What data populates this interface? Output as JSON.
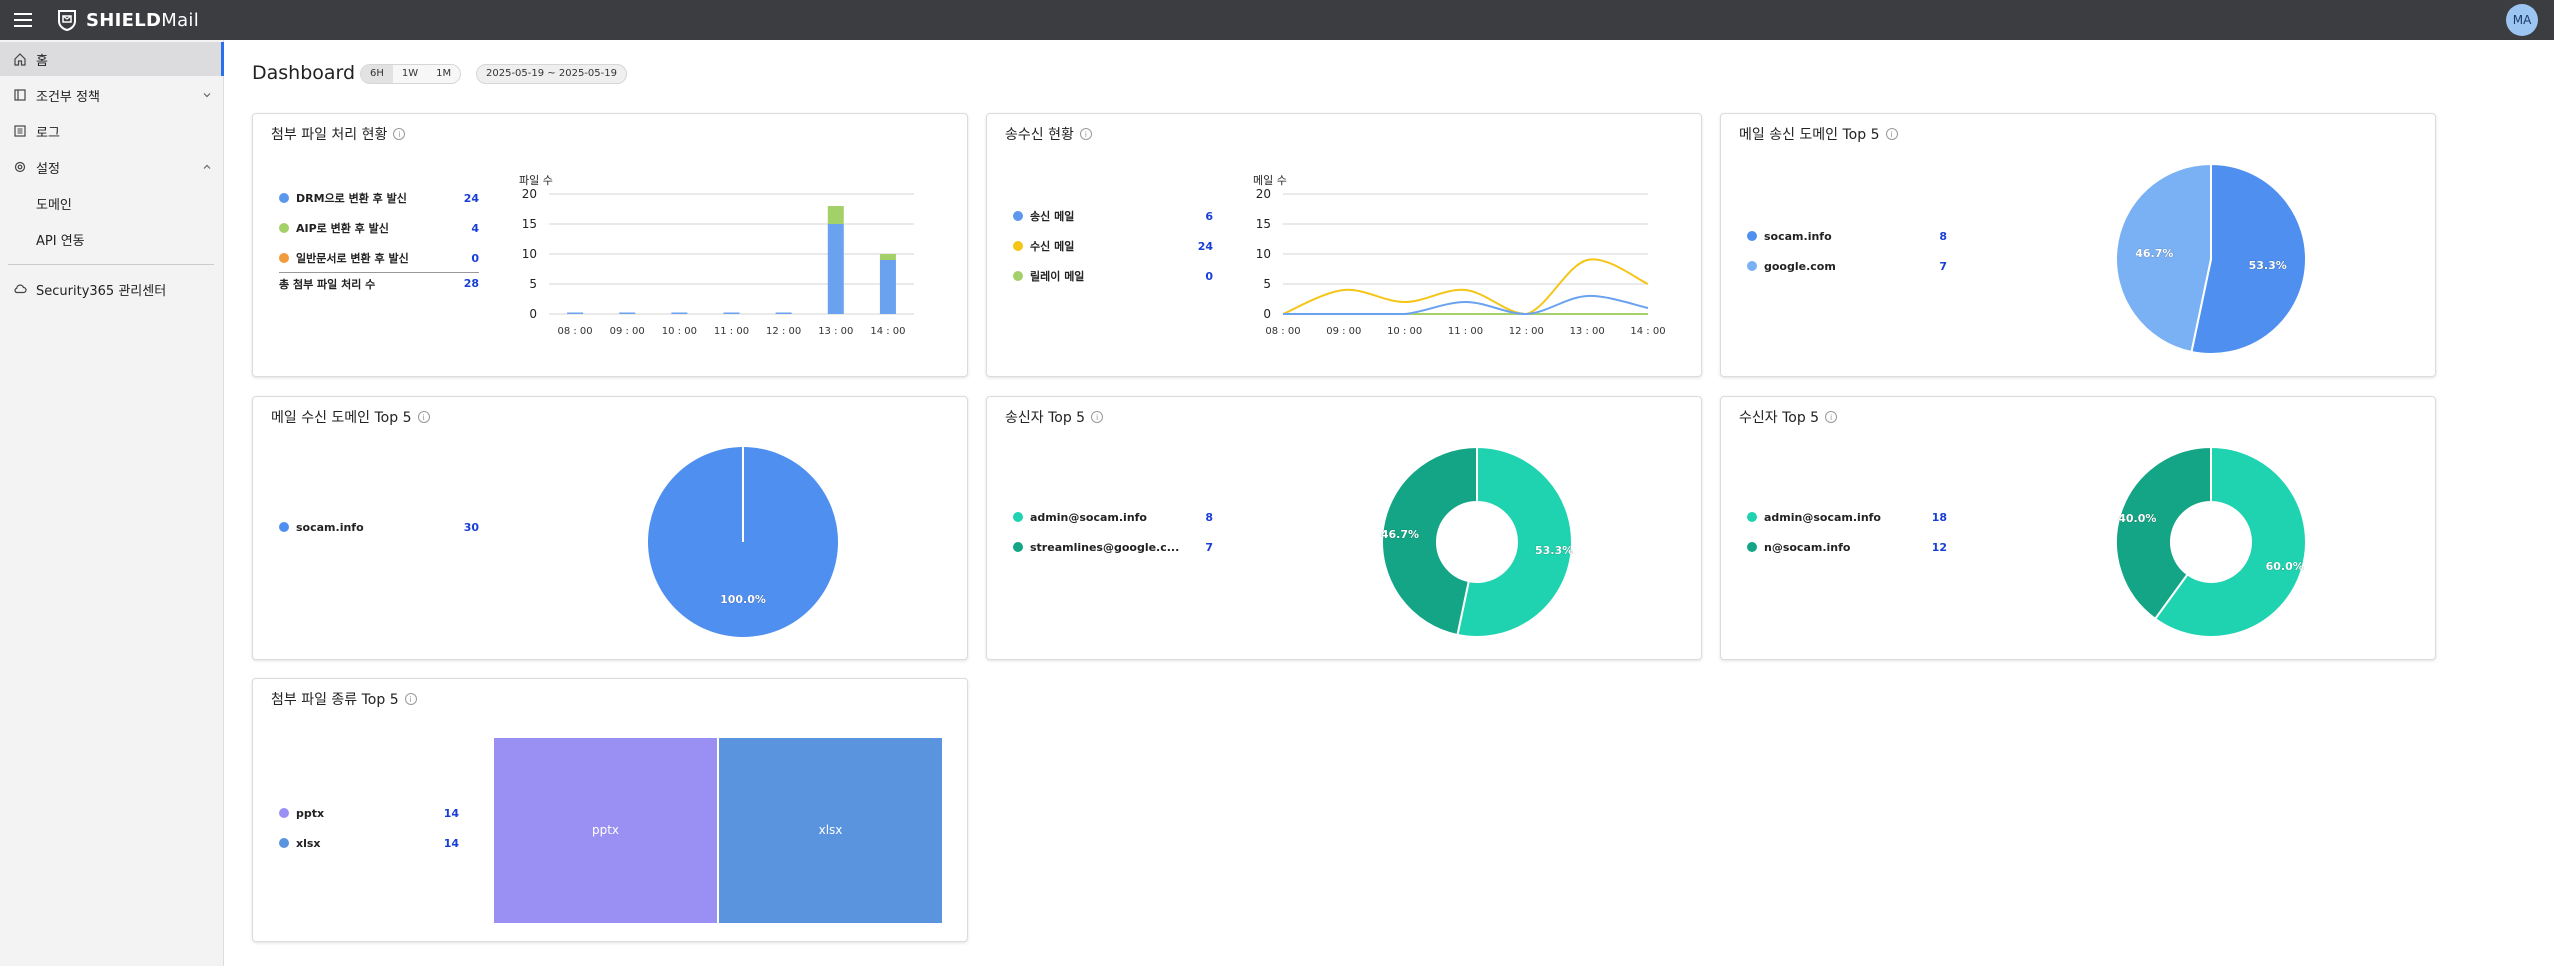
{
  "app": {
    "brand_bold": "SHIELD",
    "brand_light": "Mail",
    "avatar": "MA"
  },
  "sidebar": {
    "items": [
      {
        "label": "홈",
        "icon": "home-icon"
      },
      {
        "label": "조건부 정책",
        "icon": "policy-icon"
      },
      {
        "label": "로그",
        "icon": "log-icon"
      },
      {
        "label": "설정",
        "icon": "settings-icon"
      },
      {
        "label": "도메인"
      },
      {
        "label": "API 연동"
      },
      {
        "label": "Security365 관리센터",
        "icon": "cloud-icon"
      }
    ]
  },
  "header": {
    "title": "Dashboard",
    "ranges": [
      "6H",
      "1W",
      "1M"
    ],
    "date_range": "2025-05-19 ~ 2025-05-19"
  },
  "colors": {
    "blue": "#6aa2f0",
    "green": "#a4d06a",
    "orange": "#f39b3c",
    "yellow": "#f5c518",
    "teal": "#1fd3b0",
    "teal_dark": "#13a585",
    "pie_blue": "#4f8ff0",
    "pie_light": "#7ab1f5",
    "purple": "#9a8ff2",
    "treemap_blue": "#5a93de"
  },
  "cards": {
    "attach": {
      "title": "첨부 파일 처리 현황",
      "legend": [
        {
          "name": "DRM으로 변환 후 발신",
          "value": "24",
          "color": "#5c97ee"
        },
        {
          "name": "AIP로 변환 후 발신",
          "value": "4",
          "color": "#a4d06a"
        },
        {
          "name": "일반문서로 변환 후 발신",
          "value": "0",
          "color": "#f39b3c"
        }
      ],
      "total_label": "총 첨부 파일 처리 수",
      "total_value": "28"
    },
    "sendrecv": {
      "title": "송수신 현황",
      "legend": [
        {
          "name": "송신 메일",
          "value": "6",
          "color": "#5c97ee"
        },
        {
          "name": "수신 메일",
          "value": "24",
          "color": "#f5c518"
        },
        {
          "name": "릴레이 메일",
          "value": "0",
          "color": "#a4d06a"
        }
      ]
    },
    "senddomain": {
      "title": "메일 송신 도메인 Top 5",
      "legend": [
        {
          "name": "socam.info",
          "value": "8",
          "color": "#4f8ff0"
        },
        {
          "name": "google.com",
          "value": "7",
          "color": "#7ab1f5"
        }
      ]
    },
    "recvdomain": {
      "title": "메일 수신 도메인 Top 5",
      "legend": [
        {
          "name": "socam.info",
          "value": "30",
          "color": "#4f8ff0"
        }
      ]
    },
    "senders": {
      "title": "송신자 Top 5",
      "legend": [
        {
          "name": "admin@socam.info",
          "value": "8",
          "color": "#1fd3b0"
        },
        {
          "name": "streamlines@google.c...",
          "value": "7",
          "color": "#13a585"
        }
      ]
    },
    "receivers": {
      "title": "수신자 Top 5",
      "legend": [
        {
          "name": "admin@socam.info",
          "value": "18",
          "color": "#1fd3b0"
        },
        {
          "name": "n@socam.info",
          "value": "12",
          "color": "#13a585"
        }
      ]
    },
    "filetypes": {
      "title": "첨부 파일 종류 Top 5",
      "legend": [
        {
          "name": "pptx",
          "value": "14",
          "color": "#9a8ff2"
        },
        {
          "name": "xlsx",
          "value": "14",
          "color": "#5a93de"
        }
      ]
    }
  },
  "chart_data": [
    {
      "type": "bar",
      "title": "첨부 파일 처리 현황",
      "ylabel": "파일 수",
      "categories": [
        "08 : 00",
        "09 : 00",
        "10 : 00",
        "11 : 00",
        "12 : 00",
        "13 : 00",
        "14 : 00"
      ],
      "ylim": [
        0,
        20
      ],
      "yticks": [
        0,
        5,
        10,
        15,
        20
      ],
      "stacked": true,
      "series": [
        {
          "name": "DRM으로 변환 후 발신",
          "color": "#6aa2f0",
          "values": [
            0,
            0,
            0,
            0,
            0,
            15,
            9
          ]
        },
        {
          "name": "AIP로 변환 후 발신",
          "color": "#a4d06a",
          "values": [
            0,
            0,
            0,
            0,
            0,
            3,
            1
          ]
        },
        {
          "name": "일반문서로 변환 후 발신",
          "color": "#f39b3c",
          "values": [
            0,
            0,
            0,
            0,
            0,
            0,
            0
          ]
        }
      ]
    },
    {
      "type": "line",
      "title": "송수신 현황",
      "ylabel": "메일 수",
      "x": [
        "08 : 00",
        "09 : 00",
        "10 : 00",
        "11 : 00",
        "12 : 00",
        "13 : 00",
        "14 : 00"
      ],
      "ylim": [
        0,
        20
      ],
      "yticks": [
        0,
        5,
        10,
        15,
        20
      ],
      "series": [
        {
          "name": "송신 메일",
          "color": "#6aa2f0",
          "values": [
            0,
            0,
            0,
            2,
            0,
            3,
            1
          ]
        },
        {
          "name": "수신 메일",
          "color": "#f5c518",
          "values": [
            0,
            4,
            2,
            4,
            0,
            9,
            5
          ]
        },
        {
          "name": "릴레이 메일",
          "color": "#a4d06a",
          "values": [
            0,
            0,
            0,
            0,
            0,
            0,
            0
          ]
        }
      ]
    },
    {
      "type": "pie",
      "title": "메일 송신 도메인 Top 5",
      "labels": [
        "socam.info",
        "google.com"
      ],
      "values": [
        53.3,
        46.7
      ],
      "colors": [
        "#4f8ff0",
        "#7ab1f5"
      ],
      "display": [
        "53.3%",
        "46.7%"
      ]
    },
    {
      "type": "pie",
      "title": "메일 수신 도메인 Top 5",
      "labels": [
        "socam.info"
      ],
      "values": [
        100
      ],
      "colors": [
        "#4f8ff0"
      ],
      "display": [
        "100.0%"
      ]
    },
    {
      "type": "pie",
      "donut": true,
      "title": "송신자 Top 5",
      "labels": [
        "admin@socam.info",
        "streamlines@google.c..."
      ],
      "values": [
        53.3,
        46.7
      ],
      "colors": [
        "#1fd3b0",
        "#13a585"
      ],
      "display": [
        "53.3%",
        "46.7%"
      ]
    },
    {
      "type": "pie",
      "donut": true,
      "title": "수신자 Top 5",
      "labels": [
        "admin@socam.info",
        "n@socam.info"
      ],
      "values": [
        60,
        40
      ],
      "colors": [
        "#1fd3b0",
        "#13a585"
      ],
      "display": [
        "60.0%",
        "40.0%"
      ]
    },
    {
      "type": "treemap",
      "title": "첨부 파일 종류 Top 5",
      "labels": [
        "pptx",
        "xlsx"
      ],
      "values": [
        14,
        14
      ],
      "colors": [
        "#9a8ff2",
        "#5a93de"
      ]
    }
  ]
}
